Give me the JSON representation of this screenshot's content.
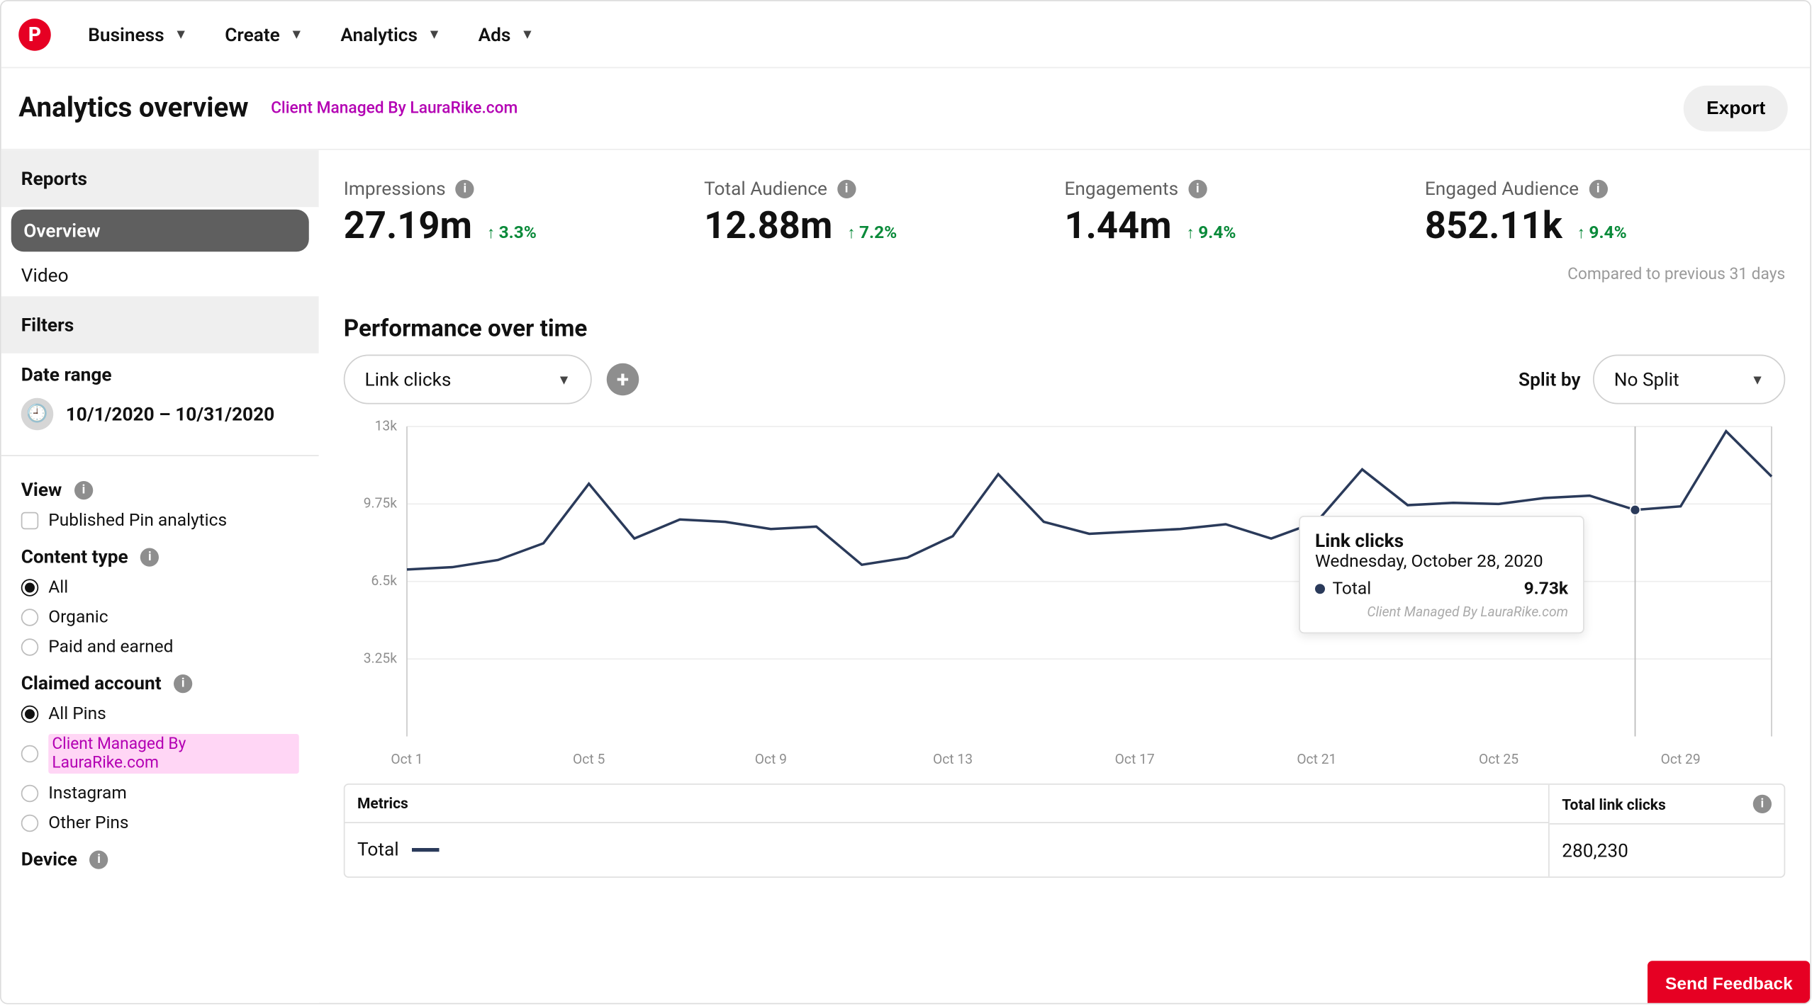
{
  "nav": {
    "business": "Business",
    "create": "Create",
    "analytics": "Analytics",
    "ads": "Ads"
  },
  "header": {
    "title": "Analytics overview",
    "client": "Client Managed By LauraRike.com",
    "export": "Export"
  },
  "sidebar": {
    "reports_header": "Reports",
    "overview": "Overview",
    "video": "Video",
    "filters_header": "Filters",
    "date_range_label": "Date range",
    "date_range": "10/1/2020 – 10/31/2020",
    "view_label": "View",
    "published_pin": "Published Pin analytics",
    "content_type_label": "Content type",
    "ct_all": "All",
    "ct_organic": "Organic",
    "ct_paid": "Paid and earned",
    "claimed_label": "Claimed account",
    "ca_all": "All Pins",
    "ca_client": "Client Managed By LauraRike.com",
    "ca_instagram": "Instagram",
    "ca_other": "Other Pins",
    "device_label": "Device"
  },
  "metrics": {
    "impressions": {
      "label": "Impressions",
      "value": "27.19m",
      "change": "3.3%"
    },
    "audience": {
      "label": "Total Audience",
      "value": "12.88m",
      "change": "7.2%"
    },
    "engagements": {
      "label": "Engagements",
      "value": "1.44m",
      "change": "9.4%"
    },
    "engaged_audience": {
      "label": "Engaged Audience",
      "value": "852.11k",
      "change": "9.4%"
    },
    "compared": "Compared to previous 31 days"
  },
  "perf": {
    "title": "Performance over time",
    "metric_dropdown": "Link clicks",
    "splitby_label": "Split by",
    "split_dropdown": "No Split"
  },
  "chart_data": {
    "type": "line",
    "xlabel": "",
    "ylabel": "",
    "ylim": [
      0,
      13000
    ],
    "yticks": [
      "13k",
      "9.75k",
      "6.5k",
      "3.25k"
    ],
    "xticks": [
      "Oct 1",
      "Oct 5",
      "Oct 9",
      "Oct 13",
      "Oct 17",
      "Oct 21",
      "Oct 25",
      "Oct 29"
    ],
    "categories": [
      "Oct 1",
      "Oct 2",
      "Oct 3",
      "Oct 4",
      "Oct 5",
      "Oct 6",
      "Oct 7",
      "Oct 8",
      "Oct 9",
      "Oct 10",
      "Oct 11",
      "Oct 12",
      "Oct 13",
      "Oct 14",
      "Oct 15",
      "Oct 16",
      "Oct 17",
      "Oct 18",
      "Oct 19",
      "Oct 20",
      "Oct 21",
      "Oct 22",
      "Oct 23",
      "Oct 24",
      "Oct 25",
      "Oct 26",
      "Oct 27",
      "Oct 28",
      "Oct 29",
      "Oct 30",
      "Oct 31"
    ],
    "series": [
      {
        "name": "Total",
        "values": [
          7000,
          7100,
          7400,
          8100,
          10600,
          8300,
          9100,
          9000,
          8700,
          8800,
          7200,
          7500,
          8400,
          11000,
          9000,
          8500,
          8600,
          8700,
          8900,
          8300,
          9000,
          11200,
          9700,
          9800,
          9750,
          10000,
          10100,
          9500,
          9650,
          12800,
          10900
        ]
      }
    ]
  },
  "tooltip": {
    "title": "Link clicks",
    "date": "Wednesday, October 28, 2020",
    "series_label": "Total",
    "value": "9.73k",
    "client": "Client Managed By LauraRike.com"
  },
  "table": {
    "left_head": "Metrics",
    "right_head": "Total link clicks",
    "row_label": "Total",
    "row_value": "280,230"
  },
  "feedback": "Send Feedback"
}
